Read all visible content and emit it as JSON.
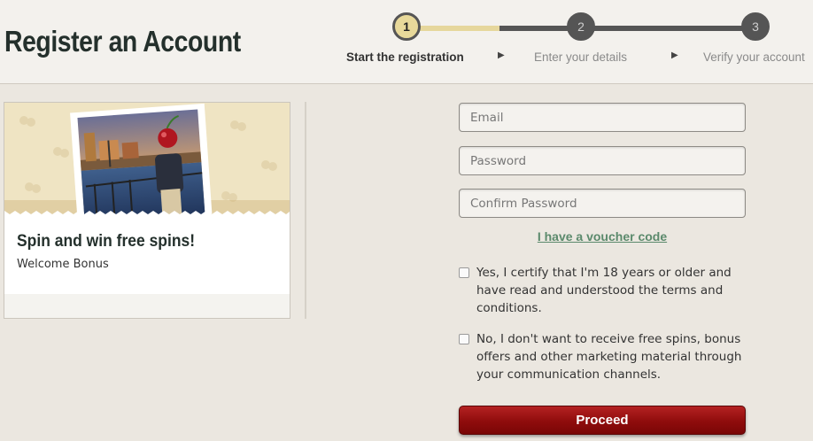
{
  "header": {
    "title": "Register an Account",
    "steps": [
      {
        "number": "1",
        "label": "Start the registration",
        "active": true
      },
      {
        "number": "2",
        "label": "Enter your details",
        "active": false
      },
      {
        "number": "3",
        "label": "Verify your account",
        "active": false
      }
    ]
  },
  "promo": {
    "title": "Spin and win free spins!",
    "subtitle": "Welcome Bonus"
  },
  "form": {
    "email_placeholder": "Email",
    "password_placeholder": "Password",
    "confirm_password_placeholder": "Confirm Password",
    "voucher_link": "I have a voucher code",
    "age_terms_checkbox": {
      "label": "Yes, I certify that I'm 18 years or older and have read and understood the terms and conditions.",
      "checked": false
    },
    "marketing_opt_out_checkbox": {
      "label": "No, I don't want to receive free spins, bonus offers and other marketing material through your communication channels.",
      "checked": false
    },
    "proceed_label": "Proceed"
  },
  "colors": {
    "accent_gold": "#e8d99a",
    "step_inactive": "#555555",
    "link_green": "#5b8a6c",
    "button_red": "#8f0c0c"
  }
}
